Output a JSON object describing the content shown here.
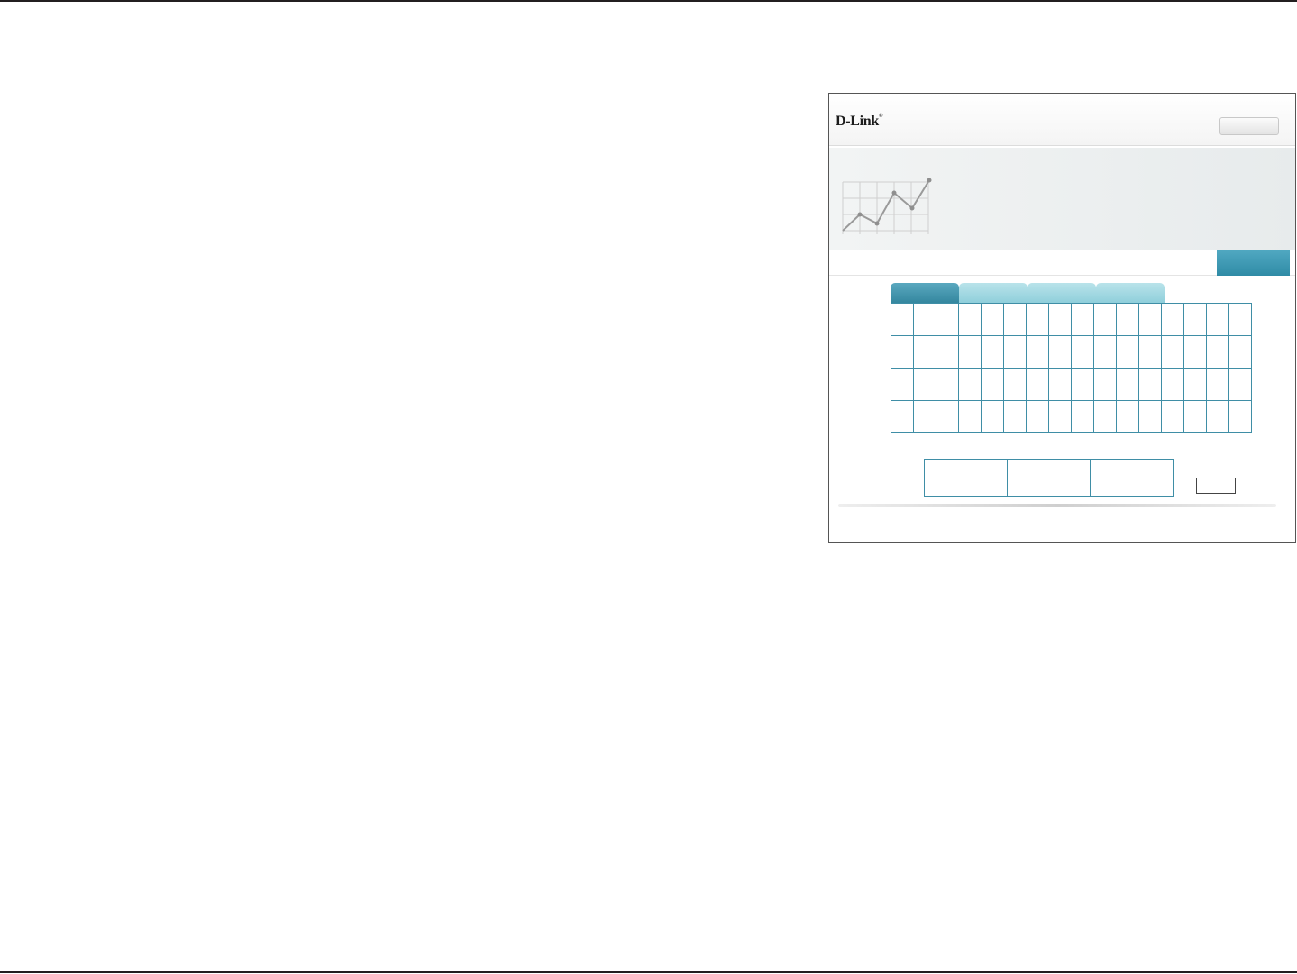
{
  "app": {
    "brand": "D-Link",
    "brand_mark": "®"
  },
  "header": {
    "logout_label": ""
  },
  "nav": {
    "next_label": ""
  },
  "tabs": [
    {
      "label": "",
      "active": true
    },
    {
      "label": "",
      "active": false
    },
    {
      "label": "",
      "active": false
    },
    {
      "label": "",
      "active": false
    }
  ],
  "grid": {
    "rows": 4,
    "cols": 16
  },
  "summary": {
    "rows": [
      [
        "",
        "",
        ""
      ],
      [
        "",
        "",
        ""
      ]
    ]
  },
  "actions": {
    "save_label": ""
  },
  "colors": {
    "accent": "#3f8ea6",
    "tab_active": "#3a8ca4",
    "tab_inactive": "#a6d9e3"
  },
  "icons": {
    "hero": "line-chart-icon"
  }
}
